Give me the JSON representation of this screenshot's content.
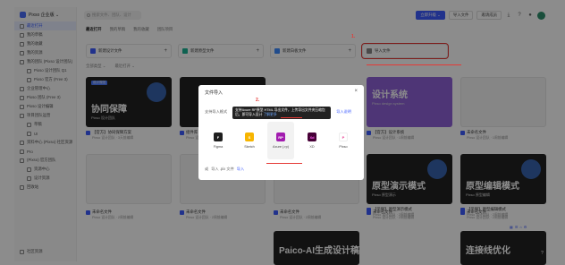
{
  "sidebar": {
    "team_name": "Pixso 企业版 ⌄",
    "items": [
      {
        "label": "最近打开",
        "active": true
      },
      {
        "label": "我的草稿"
      },
      {
        "label": "我的收藏"
      },
      {
        "label": "我的资源"
      },
      {
        "label": "我的团队 (Pixso 设计团队)"
      },
      {
        "label": "Pixso 设计团队 Q1"
      },
      {
        "label": "Pixso 官方 (Free 3)"
      },
      {
        "label": "企业管理中心"
      },
      {
        "label": "Pixso 团队 (Free 3)"
      },
      {
        "label": "Pixso 设计编辑"
      },
      {
        "label": "项目团队运营"
      },
      {
        "label": "草稿"
      },
      {
        "label": "UI"
      },
      {
        "label": "资料中心 (Pixso) 社区资源"
      },
      {
        "label": "Pro"
      },
      {
        "label": "(Pixso) 官方团队"
      },
      {
        "label": "资源中心"
      },
      {
        "label": "设计资源"
      },
      {
        "label": "回收站"
      }
    ],
    "bottom_label": "社区资源"
  },
  "topbar": {
    "search_placeholder": "搜索文件、团队、设计",
    "upgrade_label": "立即升级 ⌄",
    "import_label": "导入文件",
    "invite_label": "邀请成员"
  },
  "tabs": [
    "最近打开",
    "我的草稿",
    "我的收藏",
    "团队项目"
  ],
  "create_cards": [
    {
      "label": "新建设计文件",
      "color": "#3d5cff"
    },
    {
      "label": "新建原型文件",
      "color": "#1ab394"
    },
    {
      "label": "新建白板文件",
      "color": "#3d8bff"
    },
    {
      "label": "导入文件",
      "color": "#888888"
    }
  ],
  "filters": [
    "全部类型 ⌄",
    "最近打开 ⌄"
  ],
  "cards_row1": [
    {
      "big": "协同保障",
      "small": "Pixso 设计团队",
      "tag": "设计规范",
      "title": "【官方】协同保障方案",
      "meta": "Pixso 设计团队 · 3天前编辑",
      "theme": "dark"
    },
    {
      "big": "",
      "small": "",
      "tag": "",
      "title": "组件库",
      "meta": "Pixso 设计团队 · 5天前编辑",
      "theme": "dark"
    },
    {
      "big": "设计系统",
      "small": "Pixso design system",
      "tag": "",
      "title": "【官方】设计系统",
      "meta": "Pixso 设计团队 · 1周前编辑",
      "theme": "purple"
    },
    {
      "big": "",
      "small": "",
      "tag": "",
      "title": "未命名文件",
      "meta": "Pixso 设计团队 · 1周前编辑",
      "theme": "light"
    }
  ],
  "cards_row2": [
    {
      "big": "原型演示模式",
      "small": "Pixso 原型演示",
      "title": "【示例】原型演示模式",
      "meta": "Pixso 设计团队 · 2周前编辑"
    },
    {
      "big": "原型编辑模式",
      "small": "Pixso 原型编辑",
      "title": "【示例】原型编辑模式",
      "meta": "Pixso 设计团队 · 2周前编辑"
    }
  ],
  "cards_row3": [
    {
      "title": "未命名文件",
      "meta": "Pixso 设计团队 · 2周前编辑"
    },
    {
      "title": "未命名文件",
      "meta": "Pixso 设计团队 · 2周前编辑"
    },
    {
      "title": "未命名文件",
      "meta": "Pixso 设计团队 · 2周前编辑"
    },
    {
      "title": "未命名文件",
      "meta": "Pixso 设计团队 · 2周前编辑"
    },
    {
      "title": "未命名文件",
      "meta": "Pixso 设计团队 · 2周前编辑"
    }
  ],
  "row4": [
    {
      "big": "Paico-AI生成设计稿",
      "title": "Paico-AI生成设计稿"
    },
    {
      "big": "连接线优化",
      "title": "连接线优化"
    }
  ],
  "modal": {
    "title": "文件导入",
    "close": "×",
    "row_label": "支持导入格式",
    "doc_link": "导入说明",
    "tooltip_text": "支持Axure RP原型 HTML 导出文件，上传导出文件夹压缩包后，即可导入设计",
    "tooltip_link": "了解更多",
    "formats": [
      {
        "name": "Figma",
        "logo": "F",
        "color": "#1e1e1e"
      },
      {
        "name": "Sketch",
        "logo": "S",
        "color": "#f7b500"
      },
      {
        "name": "Axure (.rp)",
        "logo": "RP",
        "color": "#a21caf",
        "selected": true
      },
      {
        "name": "XD",
        "logo": "Xd",
        "color": "#470137"
      },
      {
        "name": "Pixso",
        "logo": "P",
        "color": "#ffffff"
      }
    ],
    "foot_label": "或",
    "foot_text": "导入 .pix 文件",
    "foot_link": "导入"
  },
  "annotations": {
    "step1": "1.",
    "step2": "2."
  }
}
